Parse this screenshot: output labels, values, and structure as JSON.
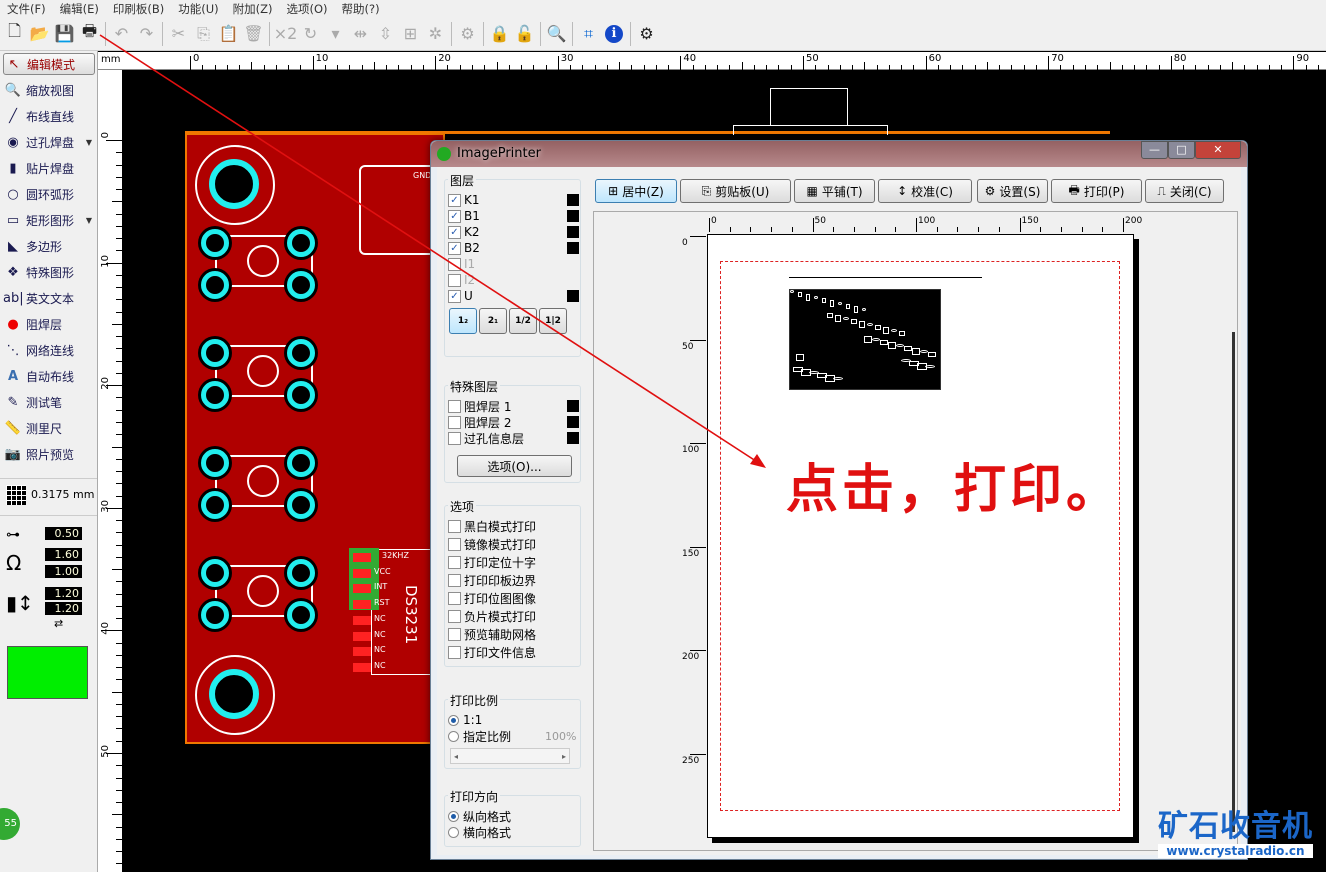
{
  "menu": [
    "文件(F)",
    "编辑(E)",
    "印刷板(B)",
    "功能(U)",
    "附加(Z)",
    "选项(O)",
    "帮助(?)"
  ],
  "toolbar": [
    {
      "icon": "new-file-icon",
      "g": "🗋",
      "dis": false
    },
    {
      "icon": "open-folder-icon",
      "g": "📂",
      "dis": false
    },
    {
      "icon": "save-icon",
      "g": "💾",
      "dis": false
    },
    {
      "icon": "print-icon",
      "g": "🖶",
      "dis": false
    },
    {
      "sep": true
    },
    {
      "icon": "undo-icon",
      "g": "↶",
      "dis": true
    },
    {
      "icon": "redo-icon",
      "g": "↷",
      "dis": true
    },
    {
      "sep": true
    },
    {
      "icon": "cut-icon",
      "g": "✂",
      "dis": true
    },
    {
      "icon": "copy-icon",
      "g": "⎘",
      "dis": true
    },
    {
      "icon": "paste-icon",
      "g": "📋",
      "dis": true
    },
    {
      "icon": "delete-icon",
      "g": "🗑",
      "dis": true
    },
    {
      "sep": true
    },
    {
      "icon": "duplicate-x2-icon",
      "g": "×2",
      "dis": true
    },
    {
      "icon": "rotate-icon",
      "g": "↻",
      "dis": true
    },
    {
      "icon": "dropdown-icon",
      "g": "▾",
      "dis": true
    },
    {
      "icon": "mirror-horizontal-icon",
      "g": "⇹",
      "dis": true
    },
    {
      "icon": "mirror-vertical-icon",
      "g": "⇳",
      "dis": true
    },
    {
      "icon": "align-icon",
      "g": "⊞",
      "dis": true
    },
    {
      "icon": "group-icon",
      "g": "✲",
      "dis": true
    },
    {
      "sep": true
    },
    {
      "icon": "component-icon",
      "g": "⚙",
      "dis": true
    },
    {
      "sep": true
    },
    {
      "icon": "lock-icon",
      "g": "🔒",
      "dis": true
    },
    {
      "icon": "unlock-icon",
      "g": "🔓",
      "dis": true
    },
    {
      "sep": true
    },
    {
      "icon": "zoom-icon",
      "g": "🔍",
      "dis": false
    },
    {
      "sep": true
    },
    {
      "icon": "crop-icon",
      "g": "⌗",
      "dis": false
    },
    {
      "icon": "info-icon",
      "g": "ℹ",
      "dis": false
    },
    {
      "sep": true
    },
    {
      "icon": "settings-gear-icon",
      "g": "⚙",
      "dis": false
    }
  ],
  "sidebar": {
    "tools": [
      {
        "label": "编辑模式",
        "icon": "cursor-arrow-icon",
        "g": "↖",
        "active": true
      },
      {
        "label": "缩放视图",
        "icon": "magnifier-icon",
        "g": "🔍"
      },
      {
        "label": "布线直线",
        "icon": "track-line-icon",
        "g": "╱"
      },
      {
        "label": "过孔焊盘",
        "icon": "via-pad-icon",
        "g": "◉",
        "dd": true
      },
      {
        "label": "贴片焊盘",
        "icon": "smd-pad-icon",
        "g": "▮"
      },
      {
        "label": "圆环弧形",
        "icon": "circle-arc-icon",
        "g": "○"
      },
      {
        "label": "矩形图形",
        "icon": "rectangle-icon",
        "g": "▭",
        "dd": true
      },
      {
        "label": "多边形",
        "icon": "polygon-icon",
        "g": "◣"
      },
      {
        "label": "特殊图形",
        "icon": "special-shape-icon",
        "g": "❖"
      },
      {
        "label": "英文文本",
        "icon": "text-icon",
        "g": "ab|"
      },
      {
        "label": "阻焊层",
        "icon": "solder-mask-icon",
        "g": "●"
      },
      {
        "label": "网络连线",
        "icon": "net-connection-icon",
        "g": "⋱"
      },
      {
        "label": "自动布线",
        "icon": "autoroute-icon",
        "g": "A"
      },
      {
        "label": "测试笔",
        "icon": "test-probe-icon",
        "g": "✎"
      },
      {
        "label": "测里尺",
        "icon": "ruler-icon",
        "g": "📏"
      },
      {
        "label": "照片预览",
        "icon": "camera-icon",
        "g": "📷"
      }
    ],
    "grid": "0.3175 mm",
    "track_width": "0.50",
    "pad_outer": "1.60",
    "pad_inner": "1.00",
    "smd_w": "1.20",
    "smd_h": "1.20",
    "color_swatch": "#00ee00"
  },
  "ruler": {
    "unit": "mm",
    "top": [
      "0",
      "10",
      "20",
      "30",
      "40",
      "50",
      "60",
      "70",
      "80",
      "90"
    ],
    "left": [
      "0",
      "10",
      "20",
      "30",
      "40",
      "50"
    ]
  },
  "pcb": {
    "labels": [
      "32KHZ",
      "VCC",
      "INT",
      "RST",
      "NC",
      "NC",
      "NC",
      "NC"
    ],
    "chip": "DS3231",
    "gnd": "GND"
  },
  "dialog": {
    "title": "ImagePrinter",
    "buttons": [
      {
        "label": "居中(Z)",
        "icon": "center-icon",
        "g": "⊞"
      },
      {
        "label": "剪贴板(U)",
        "icon": "clipboard-icon",
        "g": "⎘"
      },
      {
        "label": "平铺(T)",
        "icon": "tile-icon",
        "g": "▦"
      },
      {
        "label": "校准(C)",
        "icon": "calibrate-icon",
        "g": "↕"
      },
      {
        "label": "设置(S)",
        "icon": "setup-icon",
        "g": "⚙"
      },
      {
        "label": "打印(P)",
        "icon": "printer-icon",
        "g": "🖶"
      },
      {
        "label": "关闭(C)",
        "icon": "close-door-icon",
        "g": "⎍"
      }
    ],
    "help": "?",
    "layers_title": "图层",
    "layers": [
      {
        "name": "K1",
        "on": true
      },
      {
        "name": "B1",
        "on": true
      },
      {
        "name": "K2",
        "on": true
      },
      {
        "name": "B2",
        "on": true
      },
      {
        "name": "I1",
        "on": false,
        "dis": true
      },
      {
        "name": "I2",
        "on": false,
        "dis": true
      },
      {
        "name": "U",
        "on": true
      }
    ],
    "layer_modes": [
      "1₂",
      "2₁",
      "1/2",
      "1|2"
    ],
    "special_title": "特殊图层",
    "special": [
      "阻焊层 1",
      "阻焊层 2",
      "过孔信息层"
    ],
    "options_button": "选项(O)...",
    "options_title": "选项",
    "options": [
      "黑白模式打印",
      "镜像模式打印",
      "打印定位十字",
      "打印印板边界",
      "打印位图图像",
      "负片模式打印",
      "预览辅助网格",
      "打印文件信息"
    ],
    "scale_title": "打印比例",
    "scale_opts": [
      "1:1",
      "指定比例"
    ],
    "scale_value": "100%",
    "orient_title": "打印方向",
    "orient_opts": [
      "纵向格式",
      "横向格式"
    ],
    "ruler_h": [
      "0",
      "50",
      "100",
      "150",
      "200"
    ],
    "ruler_v": [
      "0",
      "50",
      "100",
      "150",
      "200",
      "250"
    ]
  },
  "annotation": "点击，打印。",
  "watermark": {
    "title": "矿石收音机",
    "url": "www.crystalradio.cn"
  },
  "corner_badge": "55"
}
